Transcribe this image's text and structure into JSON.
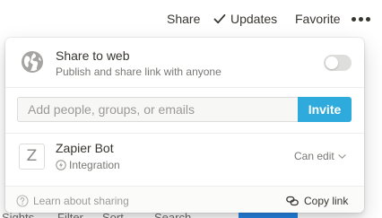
{
  "topbar": {
    "share_label": "Share",
    "updates_label": "Updates",
    "favorite_label": "Favorite",
    "more_icon": "more-horizontal-icon",
    "updates_icon": "check-icon"
  },
  "share_popup": {
    "share_to_web": {
      "title": "Share to web",
      "subtitle": "Publish and share link with anyone",
      "enabled": false,
      "icon": "globe-icon"
    },
    "invite": {
      "placeholder": "Add people, groups, or emails",
      "value": "",
      "button_label": "Invite"
    },
    "members": [
      {
        "avatar_letter": "Z",
        "name": "Zapier Bot",
        "type_label": "Integration",
        "type_icon": "integration-bolt-icon",
        "permission": "Can edit"
      }
    ],
    "footer": {
      "learn_label": "Learn about sharing",
      "learn_icon": "question-circle-icon",
      "copy_label": "Copy link",
      "copy_icon": "link-icon"
    }
  },
  "background_fragments": {
    "text_1": "Sights",
    "text_2": "Filter",
    "text_3": "Sort",
    "text_4": "Search"
  },
  "colors": {
    "text": "#37352f",
    "muted": "#787774",
    "invite_button": "#2eaadc",
    "toggle_off": "#dededc",
    "background_new_button": "#2383e2"
  }
}
